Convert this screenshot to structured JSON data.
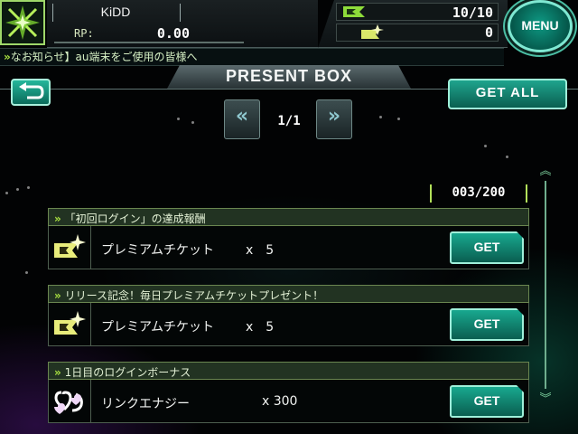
{
  "header": {
    "player_name": "KiDD",
    "rp_label": "RP:",
    "rp_value": "0.00",
    "tickets_value": "10/10",
    "premium_value": "0",
    "menu_label": "MENU"
  },
  "ticker": {
    "chevrons": "»",
    "text": "なお知らせ】au端末をご使用の皆様へ"
  },
  "title": "PRESENT BOX",
  "controls": {
    "get_all_label": "GET ALL",
    "page_indicator": "1/1",
    "prev_glyph": "«",
    "next_glyph": "»",
    "item_count": "003/200"
  },
  "items": [
    {
      "header": "「初回ログイン」の達成報酬",
      "name": "プレミアムチケット",
      "qty": "x　5",
      "icon": "premium-ticket-icon",
      "button": "GET"
    },
    {
      "header": "リリース記念！毎日プレミアムチケットプレゼント！",
      "name": "プレミアムチケット",
      "qty": "x　5",
      "icon": "premium-ticket-icon",
      "button": "GET"
    },
    {
      "header": "1日目のログインボーナス",
      "name": "リンクエナジー",
      "qty": "x 300",
      "icon": "link-energy-icon",
      "button": "GET"
    }
  ],
  "colors": {
    "accent_teal": "#18a88f",
    "accent_lime": "#a8e040",
    "header_green": "#223322"
  }
}
